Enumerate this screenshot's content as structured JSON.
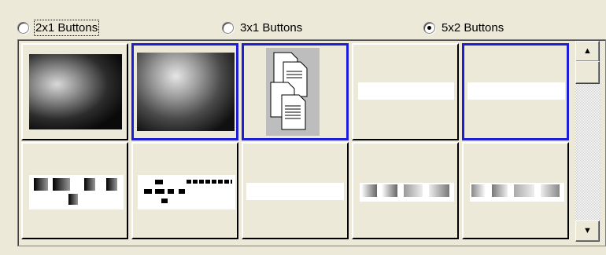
{
  "layout_options": {
    "selected": "5x2 Buttons",
    "options": [
      {
        "label": "2x1 Buttons",
        "checked": false,
        "focused": true
      },
      {
        "label": "3x1 Buttons",
        "checked": false,
        "focused": false
      },
      {
        "label": "5x2 Buttons",
        "checked": true,
        "focused": false
      }
    ]
  },
  "thumbnails": [
    {
      "kind": "xray-bitewing",
      "selected": false
    },
    {
      "kind": "xray-periapical",
      "selected": true
    },
    {
      "kind": "documents-icon",
      "selected": true
    },
    {
      "kind": "blank-strip",
      "selected": false
    },
    {
      "kind": "blank-strip",
      "selected": true
    },
    {
      "kind": "mount-template-a",
      "selected": false
    },
    {
      "kind": "mount-template-b",
      "selected": false
    },
    {
      "kind": "blank-strip",
      "selected": false
    },
    {
      "kind": "image-strip-a",
      "selected": false
    },
    {
      "kind": "image-strip-b",
      "selected": false
    }
  ],
  "scrollbar": {
    "up_icon": "triangle-up",
    "down_icon": "triangle-down"
  },
  "colors": {
    "background": "#ece9d8",
    "selection_border": "#1d1dd6"
  }
}
